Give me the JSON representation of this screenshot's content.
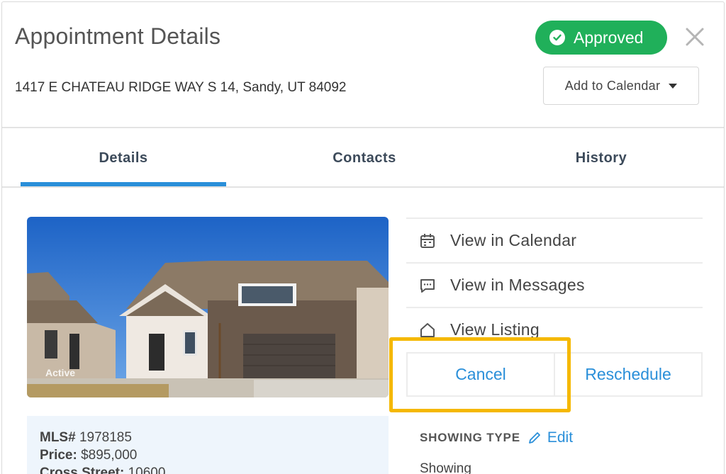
{
  "header": {
    "title": "Appointment Details",
    "address": "1417 E CHATEAU RIDGE WAY S 14, Sandy, UT 84092",
    "status": "Approved",
    "status_color": "#20b05a",
    "add_to_calendar": "Add to Calendar"
  },
  "tabs": [
    {
      "label": "Details",
      "active": true
    },
    {
      "label": "Contacts",
      "active": false
    },
    {
      "label": "History",
      "active": false
    }
  ],
  "listing": {
    "photo_badge": "Active",
    "mls_label": "MLS#",
    "mls_value": "1978185",
    "price_label": "Price:",
    "price_value": "$895,000",
    "cross_street_label": "Cross Street:",
    "cross_street_value": "10600"
  },
  "actions": {
    "view_calendar": "View in Calendar",
    "view_messages": "View in Messages",
    "view_listing": "View Listing",
    "cancel": "Cancel",
    "reschedule": "Reschedule"
  },
  "showing": {
    "label": "SHOWING TYPE",
    "edit": "Edit",
    "value": "Showing"
  },
  "colors": {
    "accent": "#2a8fd9",
    "highlight": "#f5b800"
  }
}
